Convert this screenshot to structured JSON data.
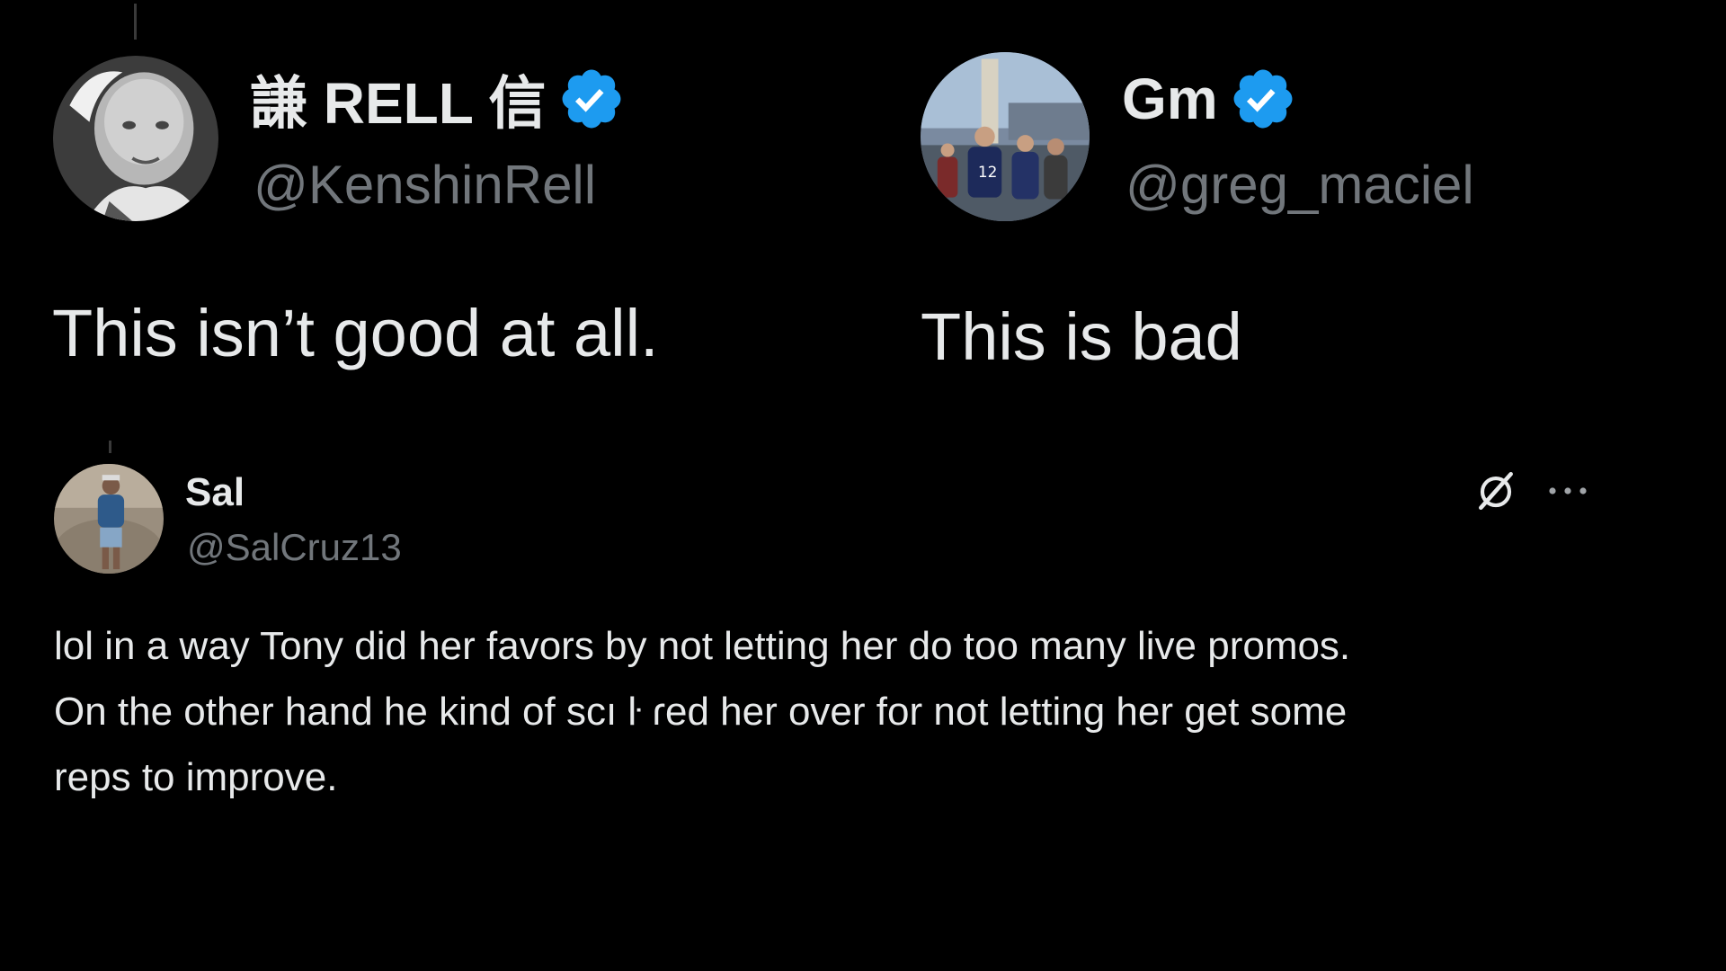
{
  "colors": {
    "background": "#000000",
    "primary_text": "#e7e9ea",
    "secondary_text": "#71767b",
    "verified_blue": "#1d9bf0"
  },
  "tweets": [
    {
      "display_name": "謙 RELL 信",
      "handle": "@KenshinRell",
      "verified": true,
      "verified_icon": "verified-badge-icon",
      "text": "This isn’t good at all."
    },
    {
      "display_name": "Gm",
      "handle": "@greg_maciel",
      "verified": true,
      "verified_icon": "verified-badge-icon",
      "text": "This is bad"
    }
  ],
  "reply": {
    "display_name": "Sal",
    "handle": "@SalCruz13",
    "text_lines": [
      "lol in a way Tony did her favors by not letting her do too many live promos.",
      "On the other hand he kind of scı ŀ ɾed her over for not letting her get some",
      "reps to improve."
    ],
    "icons": {
      "grok": "grok-icon",
      "more": "more-options-icon"
    }
  }
}
